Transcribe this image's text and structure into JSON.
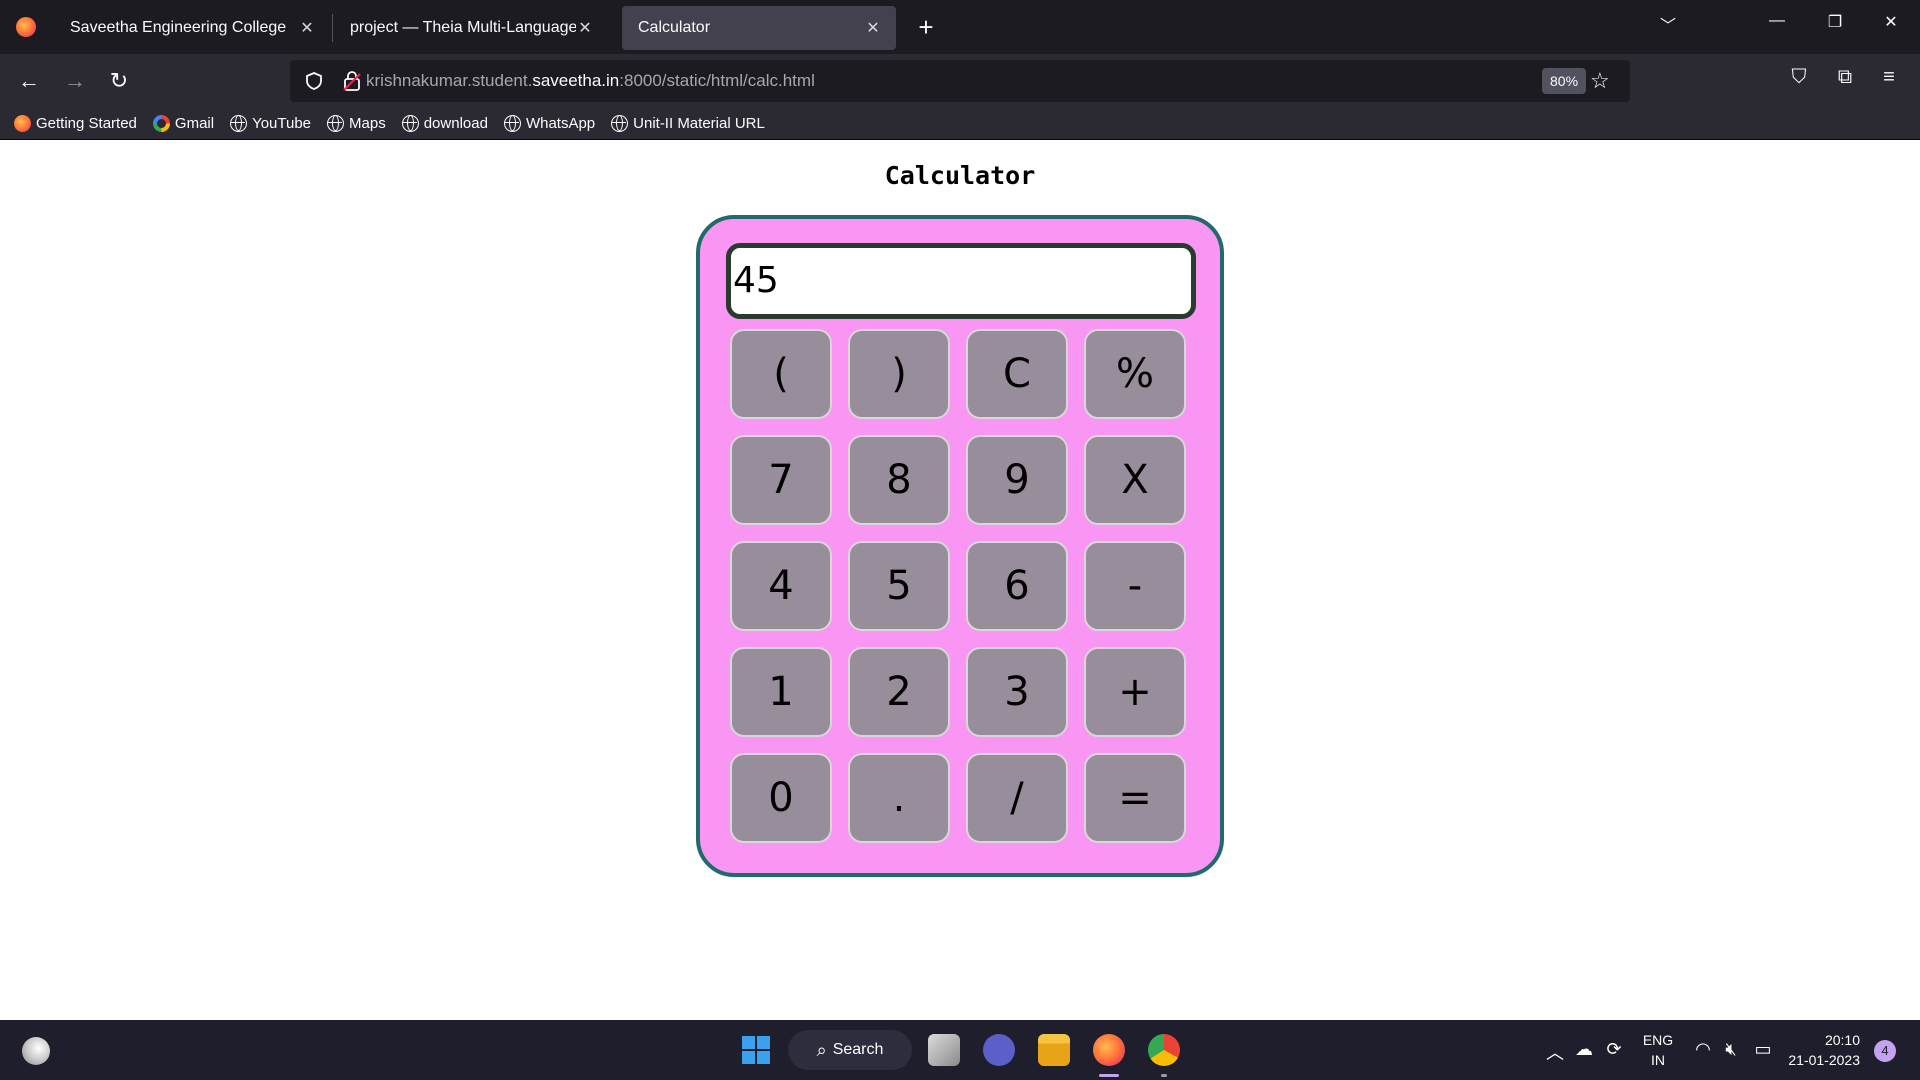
{
  "browser": {
    "tabs": [
      {
        "title": "Saveetha Engineering College",
        "active": false
      },
      {
        "title": "project — Theia Multi-Language Ex",
        "active": false
      },
      {
        "title": "Calculator",
        "active": true
      }
    ],
    "url": {
      "prefix": "krishnakumar.student.",
      "domain": "saveetha.in",
      "suffix": ":8000/static/html/calc.html"
    },
    "zoom": "80%",
    "bookmarks": [
      {
        "label": "Getting Started",
        "icon": "firefox-icon"
      },
      {
        "label": "Gmail",
        "icon": "google-icon"
      },
      {
        "label": "YouTube",
        "icon": "globe-icon"
      },
      {
        "label": "Maps",
        "icon": "globe-icon"
      },
      {
        "label": "download",
        "icon": "globe-icon"
      },
      {
        "label": "WhatsApp",
        "icon": "globe-icon"
      },
      {
        "label": "Unit-II Material URL",
        "icon": "globe-icon"
      }
    ]
  },
  "page": {
    "title": "Calculator",
    "display_value": "45",
    "keys": [
      [
        "(",
        ")",
        "C",
        "%"
      ],
      [
        "7",
        "8",
        "9",
        "X"
      ],
      [
        "4",
        "5",
        "6",
        "-"
      ],
      [
        "1",
        "2",
        "3",
        "+"
      ],
      [
        "0",
        ".",
        "/",
        "="
      ]
    ],
    "colors": {
      "body": "#f995f2",
      "border": "#1f6b6b",
      "key": "#988e9b"
    }
  },
  "taskbar": {
    "search_label": "Search",
    "language": "ENG",
    "region": "IN",
    "time": "20:10",
    "date": "21-01-2023",
    "notification_count": "4"
  }
}
